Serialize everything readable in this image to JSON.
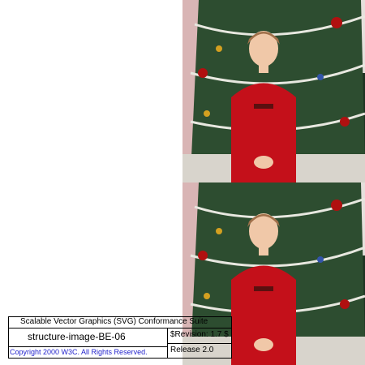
{
  "test_frame": {
    "suite_title": "Scalable Vector Graphics (SVG) Conformance Suite",
    "test_name": "structure-image-BE-06",
    "revision": "$Revision: 1.7 $",
    "release": "Release 2.0",
    "copyright": "Copyright 2000 W3C. All Rights Reserved."
  },
  "images": [
    {
      "name": "photo-top",
      "subject": "girl in red dress in front of christmas tree"
    },
    {
      "name": "photo-bottom",
      "subject": "girl in red dress in front of christmas tree"
    }
  ],
  "colors": {
    "tree_green": "#2c4a2e",
    "dress_red": "#c4101a",
    "wall_pink": "#e9c9c9",
    "copyright_blue": "#2222cc"
  }
}
